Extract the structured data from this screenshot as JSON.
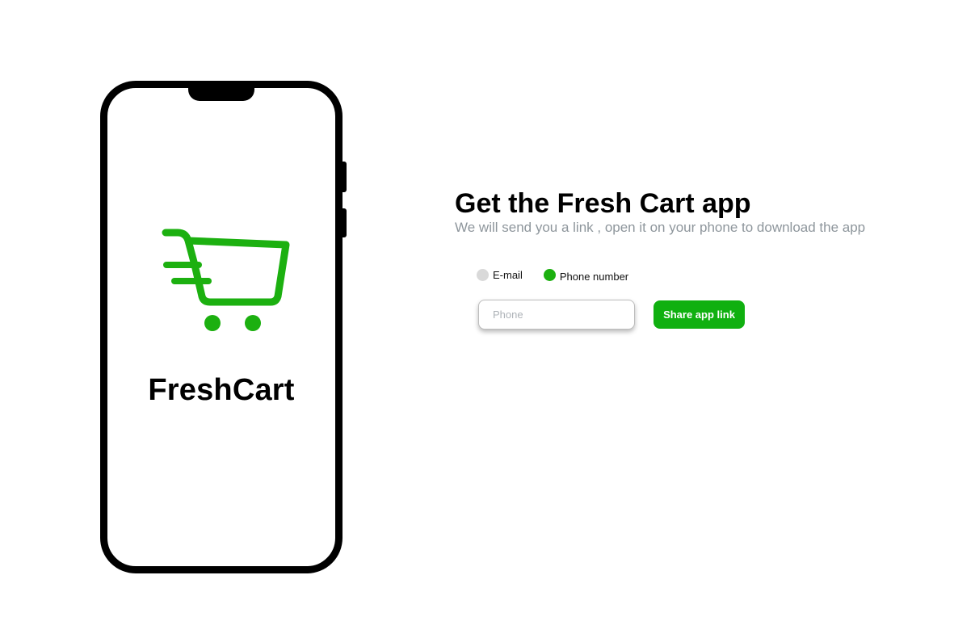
{
  "brand": {
    "name": "FreshCart",
    "logo_icon": "shopping-cart-icon",
    "accent_color": "#1cb010"
  },
  "promo": {
    "headline": "Get the Fresh Cart app",
    "subline": "We will send you a link , open it on your phone to download the app"
  },
  "contact_options": [
    {
      "label": "E-mail",
      "selected": false
    },
    {
      "label": "Phone number",
      "selected": true
    }
  ],
  "phone_field": {
    "placeholder": "Phone",
    "value": ""
  },
  "share_button": {
    "label": "Share app link",
    "color": "#10b010"
  }
}
